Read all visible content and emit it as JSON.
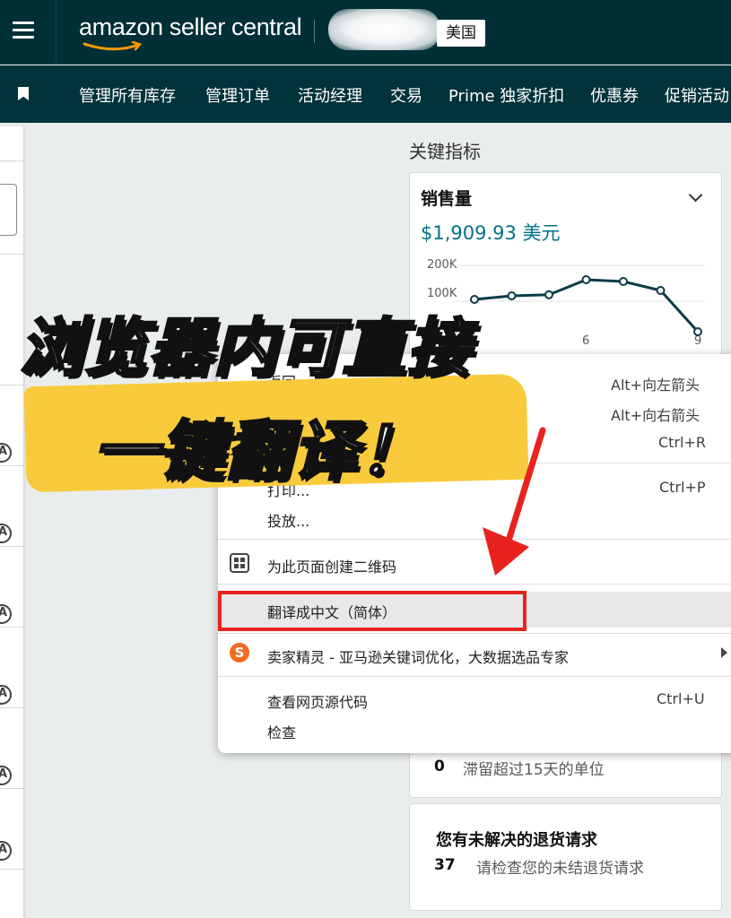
{
  "header": {
    "logo_text": "amazon seller central",
    "region": "美国"
  },
  "nav": {
    "items": [
      "管理所有库存",
      "管理订单",
      "活动经理",
      "交易",
      "Prime 独家折扣",
      "优惠券",
      "促销活动"
    ]
  },
  "metrics": {
    "title": "关键指标",
    "sales_label": "销售量",
    "sales_value": "$1,909.93 美元",
    "chart_data": {
      "type": "line",
      "x": [
        1,
        2,
        3,
        4,
        5,
        6,
        7,
        8,
        9
      ],
      "x_tick_labels": [
        "6",
        "9"
      ],
      "y": [
        105000,
        115000,
        118000,
        160000,
        155000,
        130000,
        15000
      ],
      "y_tick_labels": [
        "200K",
        "100K"
      ],
      "ylim": [
        0,
        200000
      ],
      "colors": {
        "line": "#0b3c49"
      }
    },
    "stranded": {
      "count": "0",
      "text": "滞留超过15天的单位"
    },
    "returns": {
      "title": "您有未解决的退货请求",
      "count": "37",
      "text": "请检查您的未结退货请求"
    }
  },
  "context_menu": {
    "back": {
      "label": "返回",
      "shortcut": "Alt+向左箭头"
    },
    "forward": {
      "shortcut": "Alt+向右箭头"
    },
    "reload": {
      "shortcut": "Ctrl+R"
    },
    "print": {
      "label": "打印...",
      "shortcut": "Ctrl+P"
    },
    "cast": {
      "label": "投放..."
    },
    "qr": {
      "label": "为此页面创建二维码",
      "icon": "qr-code-icon"
    },
    "translate": {
      "label": "翻译成中文（简体）"
    },
    "extension": {
      "label": "卖家精灵 - 亚马逊关键词优化，大数据选品专家",
      "icon": "sellersprite-icon",
      "icon_glyph": "S"
    },
    "view_source": {
      "label": "查看网页源代码",
      "shortcut": "Ctrl+U"
    },
    "inspect": {
      "label": "检查"
    }
  },
  "overlay": {
    "line1": "浏览器内可直接",
    "line2": "一键翻译！",
    "highlight_color": "#f9cb3c",
    "arrow_color": "#e8231f"
  }
}
